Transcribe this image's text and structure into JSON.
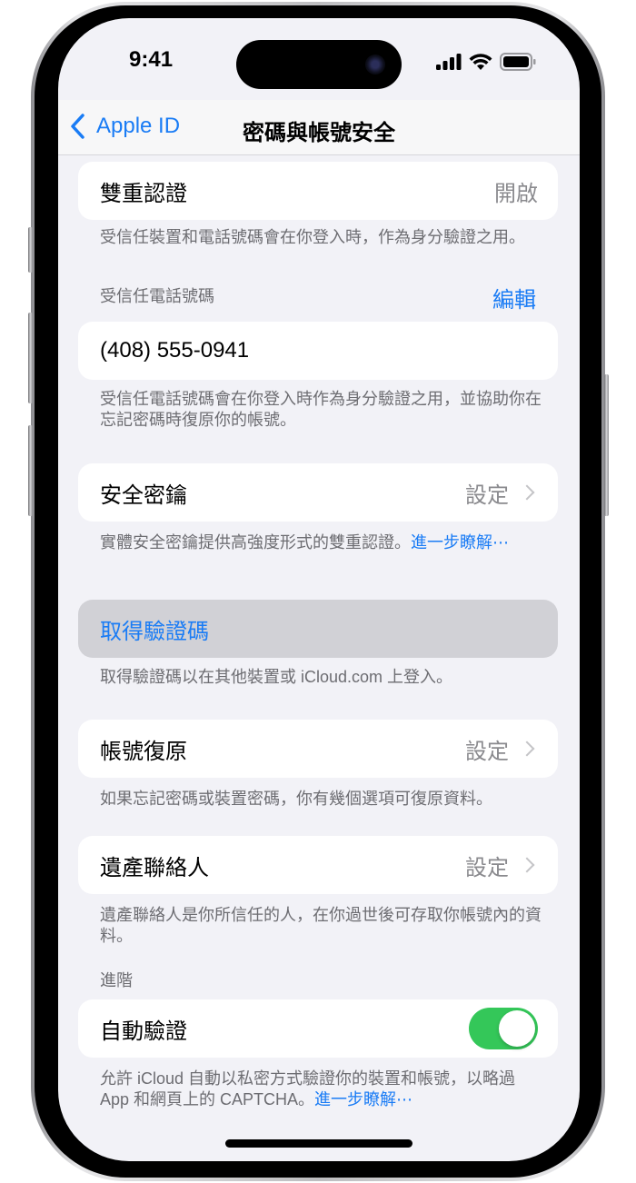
{
  "status_bar": {
    "time": "9:41"
  },
  "nav": {
    "back_label": "Apple ID",
    "title": "密碼與帳號安全"
  },
  "two_factor": {
    "label": "雙重認證",
    "value": "開啟",
    "footer": "受信任裝置和電話號碼會在你登入時，作為身分驗證之用。"
  },
  "trusted_phone": {
    "header": "受信任電話號碼",
    "edit_label": "編輯",
    "number": "(408) 555-0941",
    "footer": "受信任電話號碼會在你登入時作為身分驗證之用，並協助你在忘記密碼時復原你的帳號。"
  },
  "security_keys": {
    "label": "安全密鑰",
    "value": "設定",
    "footer": "實體安全密鑰提供高強度形式的雙重認證。",
    "footer_link": "進一步瞭解⋯"
  },
  "get_code": {
    "label": "取得驗證碼",
    "footer": "取得驗證碼以在其他裝置或 iCloud.com 上登入。"
  },
  "account_recovery": {
    "label": "帳號復原",
    "value": "設定",
    "footer": "如果忘記密碼或裝置密碼，你有幾個選項可復原資料。"
  },
  "legacy_contact": {
    "label": "遺產聯絡人",
    "value": "設定",
    "footer": "遺產聯絡人是你所信任的人，在你過世後可存取你帳號內的資料。"
  },
  "advanced": {
    "header": "進階",
    "auto_verify_label": "自動驗證",
    "auto_verify_on": true,
    "footer": "允許 iCloud 自動以私密方式驗證你的裝置和帳號，以略過 App 和網頁上的 CAPTCHA。",
    "footer_link": "進一步瞭解⋯"
  },
  "colors": {
    "accent": "#1a7cf5",
    "toggle_on": "#34c759",
    "background": "#f2f2f7"
  }
}
